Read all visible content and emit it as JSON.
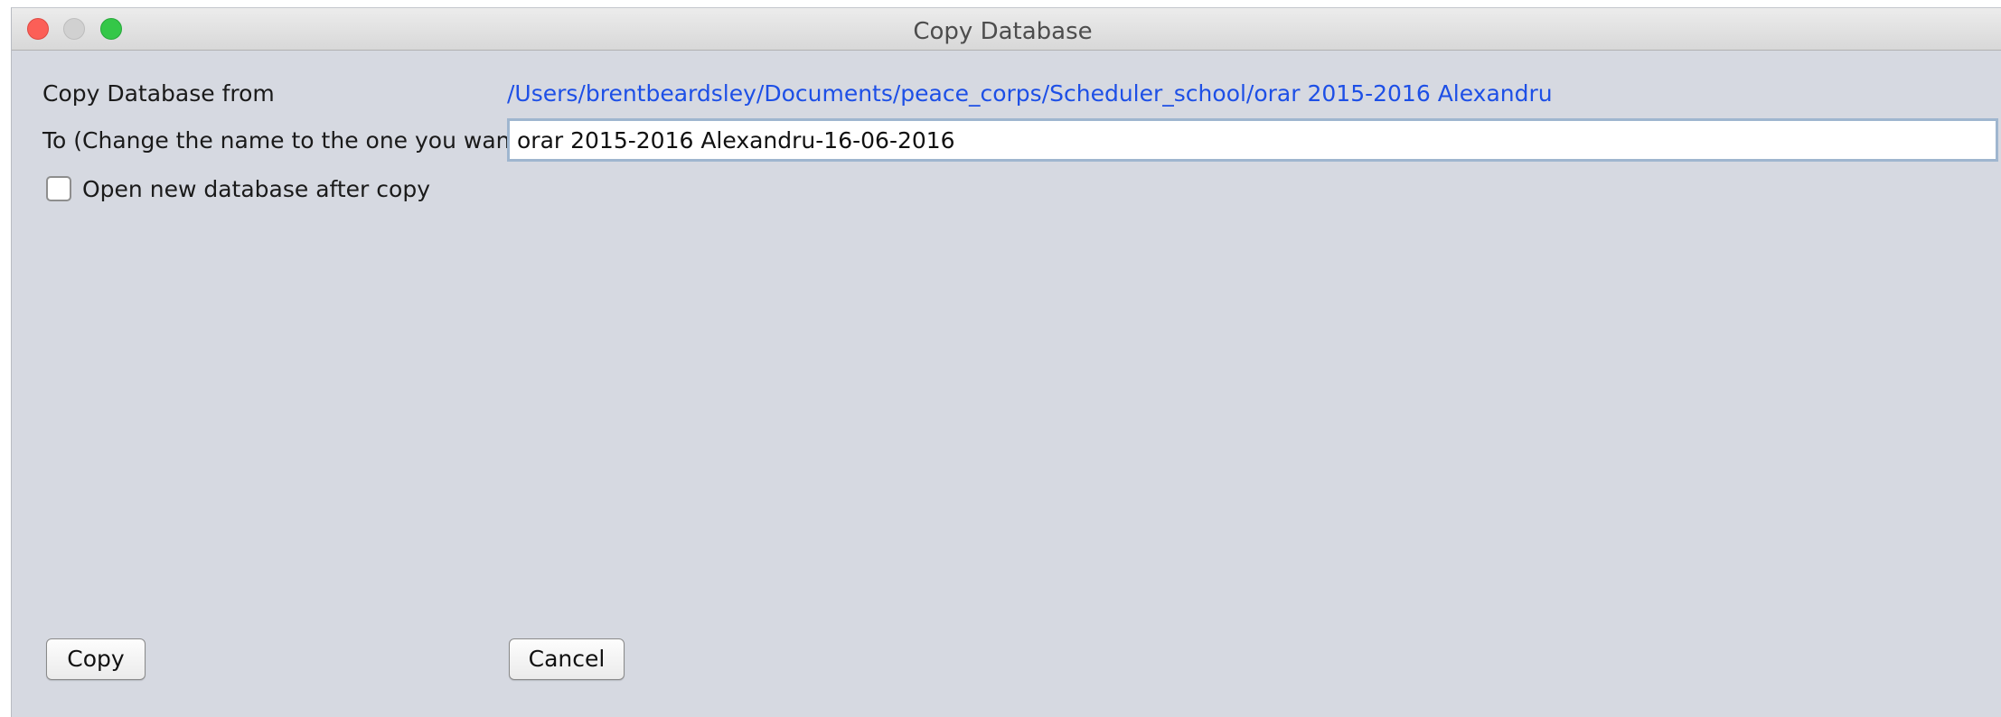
{
  "window": {
    "title": "Copy Database"
  },
  "form": {
    "copy_from_label": "Copy Database from",
    "copy_from_path": "/Users/brentbeardsley/Documents/peace_corps/Scheduler_school/orar 2015-2016 Alexandru",
    "to_label": "To (Change the name to the one you want)",
    "to_value": "orar 2015-2016 Alexandru-16-06-2016",
    "open_after_copy_label": "Open new database after copy",
    "open_after_copy_checked": false
  },
  "buttons": {
    "copy_label": "Copy",
    "cancel_label": "Cancel"
  },
  "colors": {
    "link": "#1d4fe6",
    "window_bg": "#d6d9e1",
    "close": "#fc5f57",
    "zoom": "#34c748"
  }
}
